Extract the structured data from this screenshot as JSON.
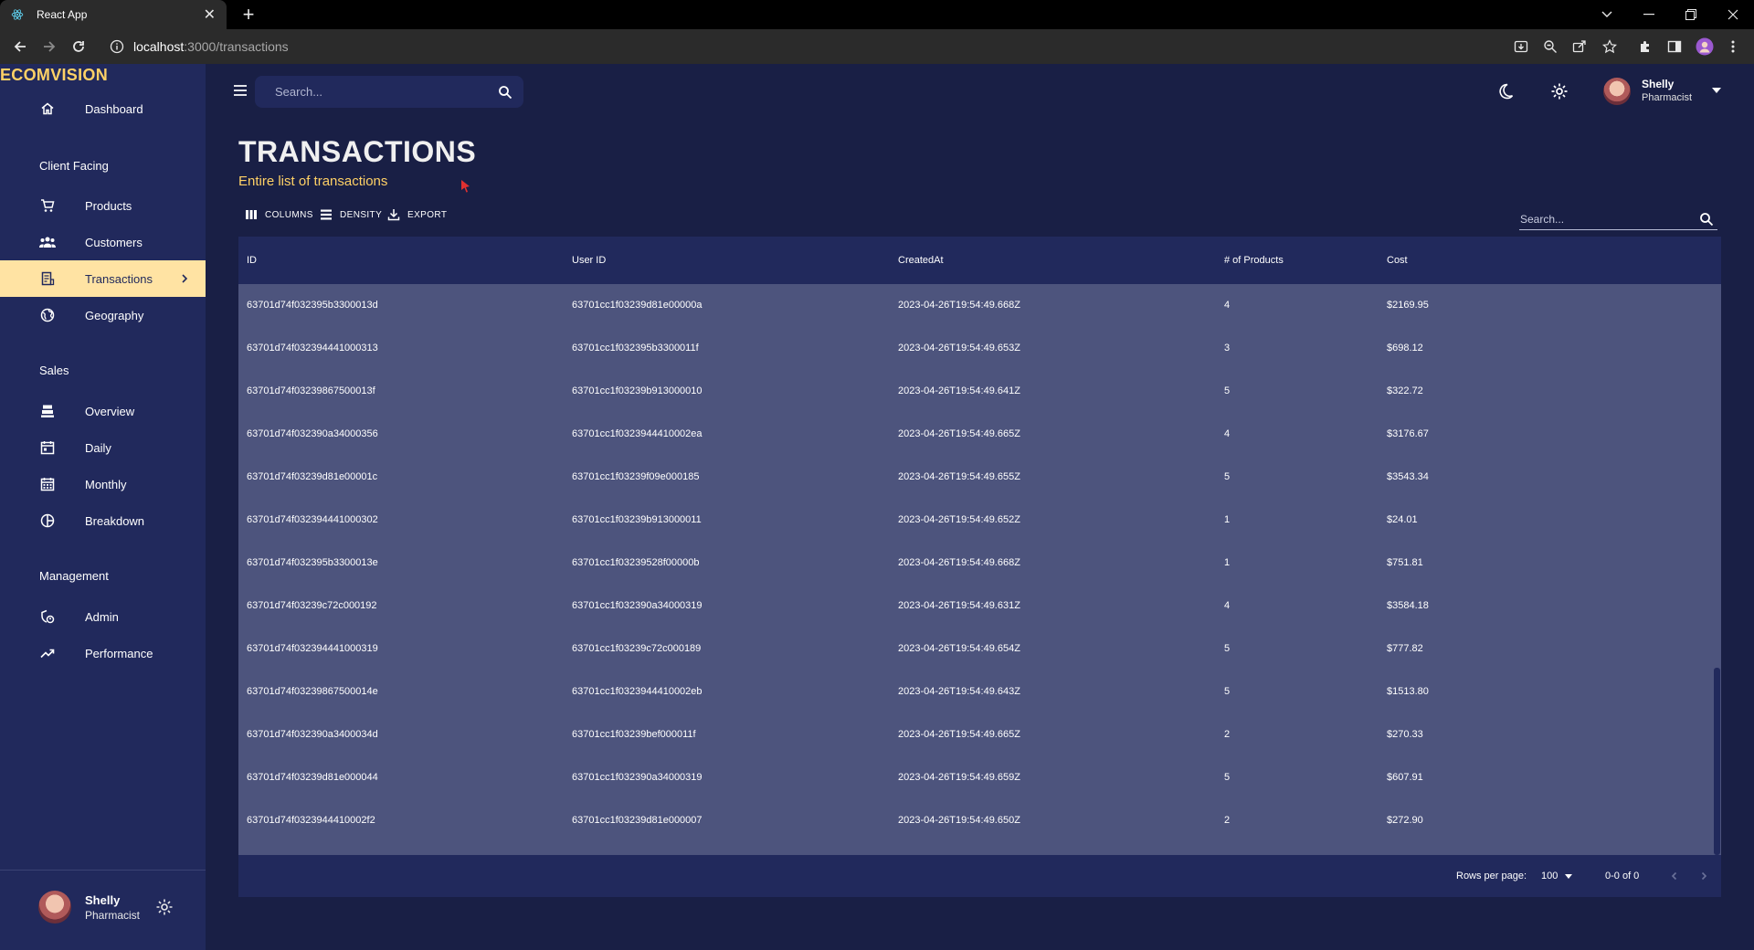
{
  "browser": {
    "tab_title": "React App",
    "url_host": "localhost",
    "url_path": ":3000/transactions"
  },
  "sidebar": {
    "brand": "ECOMVISION",
    "items": [
      {
        "label": "Dashboard",
        "icon": "home-icon"
      },
      {
        "section": "Client Facing"
      },
      {
        "label": "Products",
        "icon": "shopping-cart-icon"
      },
      {
        "label": "Customers",
        "icon": "groups-icon"
      },
      {
        "label": "Transactions",
        "icon": "receipt-icon",
        "active": true
      },
      {
        "label": "Geography",
        "icon": "globe-icon"
      },
      {
        "section": "Sales"
      },
      {
        "label": "Overview",
        "icon": "point-of-sale-icon"
      },
      {
        "label": "Daily",
        "icon": "calendar-today-icon"
      },
      {
        "label": "Monthly",
        "icon": "calendar-month-icon"
      },
      {
        "label": "Breakdown",
        "icon": "pie-chart-icon"
      },
      {
        "section": "Management"
      },
      {
        "label": "Admin",
        "icon": "admin-icon"
      },
      {
        "label": "Performance",
        "icon": "trending-up-icon"
      }
    ],
    "user": {
      "name": "Shelly",
      "role": "Pharmacist"
    }
  },
  "topbar": {
    "search_placeholder": "Search...",
    "user": {
      "name": "Shelly",
      "role": "Pharmacist"
    }
  },
  "page": {
    "title": "TRANSACTIONS",
    "subtitle": "Entire list of transactions"
  },
  "grid_toolbar": {
    "columns": "COLUMNS",
    "density": "DENSITY",
    "export": "EXPORT",
    "search_placeholder": "Search..."
  },
  "table": {
    "columns": [
      "ID",
      "User ID",
      "CreatedAt",
      "# of Products",
      "Cost"
    ],
    "rows": [
      [
        "63701d74f032395b3300013d",
        "63701cc1f03239d81e00000a",
        "2023-04-26T19:54:49.668Z",
        "4",
        "$2169.95"
      ],
      [
        "63701d74f032394441000313",
        "63701cc1f032395b3300011f",
        "2023-04-26T19:54:49.653Z",
        "3",
        "$698.12"
      ],
      [
        "63701d74f03239867500013f",
        "63701cc1f03239b913000010",
        "2023-04-26T19:54:49.641Z",
        "5",
        "$322.72"
      ],
      [
        "63701d74f032390a34000356",
        "63701cc1f0323944410002ea",
        "2023-04-26T19:54:49.665Z",
        "4",
        "$3176.67"
      ],
      [
        "63701d74f03239d81e00001c",
        "63701cc1f03239f09e000185",
        "2023-04-26T19:54:49.655Z",
        "5",
        "$3543.34"
      ],
      [
        "63701d74f032394441000302",
        "63701cc1f03239b913000011",
        "2023-04-26T19:54:49.652Z",
        "1",
        "$24.01"
      ],
      [
        "63701d74f032395b3300013e",
        "63701cc1f03239528f00000b",
        "2023-04-26T19:54:49.668Z",
        "1",
        "$751.81"
      ],
      [
        "63701d74f03239c72c000192",
        "63701cc1f032390a34000319",
        "2023-04-26T19:54:49.631Z",
        "4",
        "$3584.18"
      ],
      [
        "63701d74f032394441000319",
        "63701cc1f03239c72c000189",
        "2023-04-26T19:54:49.654Z",
        "5",
        "$777.82"
      ],
      [
        "63701d74f03239867500014e",
        "63701cc1f0323944410002eb",
        "2023-04-26T19:54:49.643Z",
        "5",
        "$1513.80"
      ],
      [
        "63701d74f032390a3400034d",
        "63701cc1f03239bef000011f",
        "2023-04-26T19:54:49.665Z",
        "2",
        "$270.33"
      ],
      [
        "63701d74f03239d81e000044",
        "63701cc1f032390a34000319",
        "2023-04-26T19:54:49.659Z",
        "5",
        "$607.91"
      ],
      [
        "63701d74f0323944410002f2",
        "63701cc1f03239d81e000007",
        "2023-04-26T19:54:49.650Z",
        "2",
        "$272.90"
      ]
    ],
    "footer": {
      "rows_per_page_label": "Rows per page:",
      "rows_per_page_value": "100",
      "range": "0-0 of 0"
    }
  },
  "colors": {
    "background": "#191f45",
    "panel": "#21295c",
    "row_bg": "#4d547d",
    "accent": "#ffd166",
    "active_nav": "#ffe3a3"
  }
}
